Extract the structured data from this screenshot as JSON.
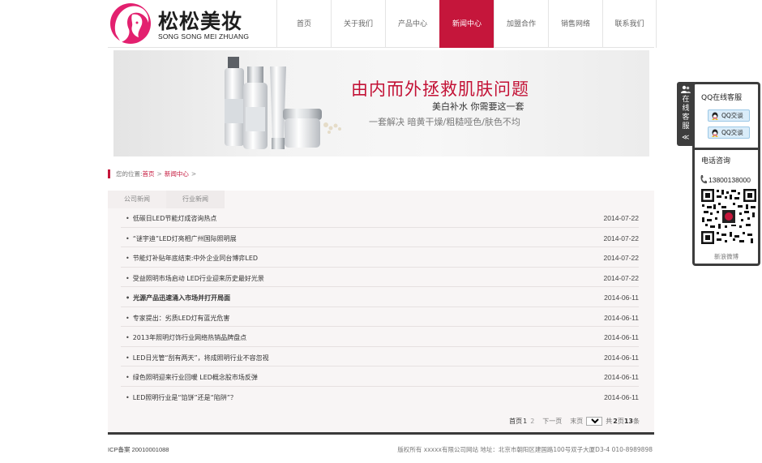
{
  "brand": {
    "name_cn": "松松美妆",
    "name_en": "SONG SONG MEI ZHUANG",
    "color": "#c5163b"
  },
  "nav": {
    "items": [
      {
        "label": "首页"
      },
      {
        "label": "关于我们"
      },
      {
        "label": "产品中心"
      },
      {
        "label": "新闻中心",
        "active": true
      },
      {
        "label": "加盟合作"
      },
      {
        "label": "销售网络"
      },
      {
        "label": "联系我们"
      }
    ]
  },
  "banner": {
    "headline": "由内而外拯救肌肤问题",
    "sub1": "美白补水 你需要这一套",
    "sub2": "一套解决 暗黄干燥/粗糙哑色/肤色不均"
  },
  "breadcrumb": {
    "prefix": "您的位置:",
    "home": "首页",
    "section": "新闻中心",
    "sep": ">"
  },
  "tabs": [
    {
      "label": "公司新闻"
    },
    {
      "label": "行业新闻"
    }
  ],
  "news": [
    {
      "title": "低碳日LED节能灯成咨询热点",
      "date": "2014-07-22"
    },
    {
      "title": "“谜宇迪”LED灯亮相广州国际照明展",
      "date": "2014-07-22"
    },
    {
      "title": "节能灯补贴年底结束:中外企业同台博弈LED",
      "date": "2014-07-22"
    },
    {
      "title": "受益照明市场启动 LED行业迎来历史最好光景",
      "date": "2014-07-22"
    },
    {
      "title": "光源产品迅速涌入市场并打开局面",
      "date": "2014-06-11"
    },
    {
      "title": "专家提出：劣质LED灯有蓝光危害",
      "date": "2014-06-11"
    },
    {
      "title": "2013年照明灯饰行业网络热销品牌盘点",
      "date": "2014-06-11"
    },
    {
      "title": "LED日光管“刮有两天”，将成照明行业不容忽视",
      "date": "2014-06-11"
    },
    {
      "title": "绿色照明迎来行业回暖 LED概念股市场反弹",
      "date": "2014-06-11"
    },
    {
      "title": "LED照明行业是“馅饼”还是“陷阱”？",
      "date": "2014-06-11"
    }
  ],
  "pager": {
    "first": "首页",
    "current": "1",
    "page2": "2",
    "next": "下一页",
    "last": "末页",
    "select_value": "1",
    "total_prefix": "共",
    "total_pages": "2",
    "pages_unit": "页",
    "total_count": "13",
    "count_unit": "条"
  },
  "footer": {
    "icp": "ICP备案 20010001088",
    "info": "版权所有 xxxxx有限公司网站 地址：北京市朝阳区建国路100号双子大厦D3-4 010-8989898"
  },
  "service": {
    "tab_label": "在线客服",
    "tab_arrow": "≪",
    "qq_title": "QQ在线客服",
    "qq_btn": "QQ交谈",
    "phone_title": "电话咨询",
    "phone": "13800138000",
    "weibo": "新浪微博"
  }
}
